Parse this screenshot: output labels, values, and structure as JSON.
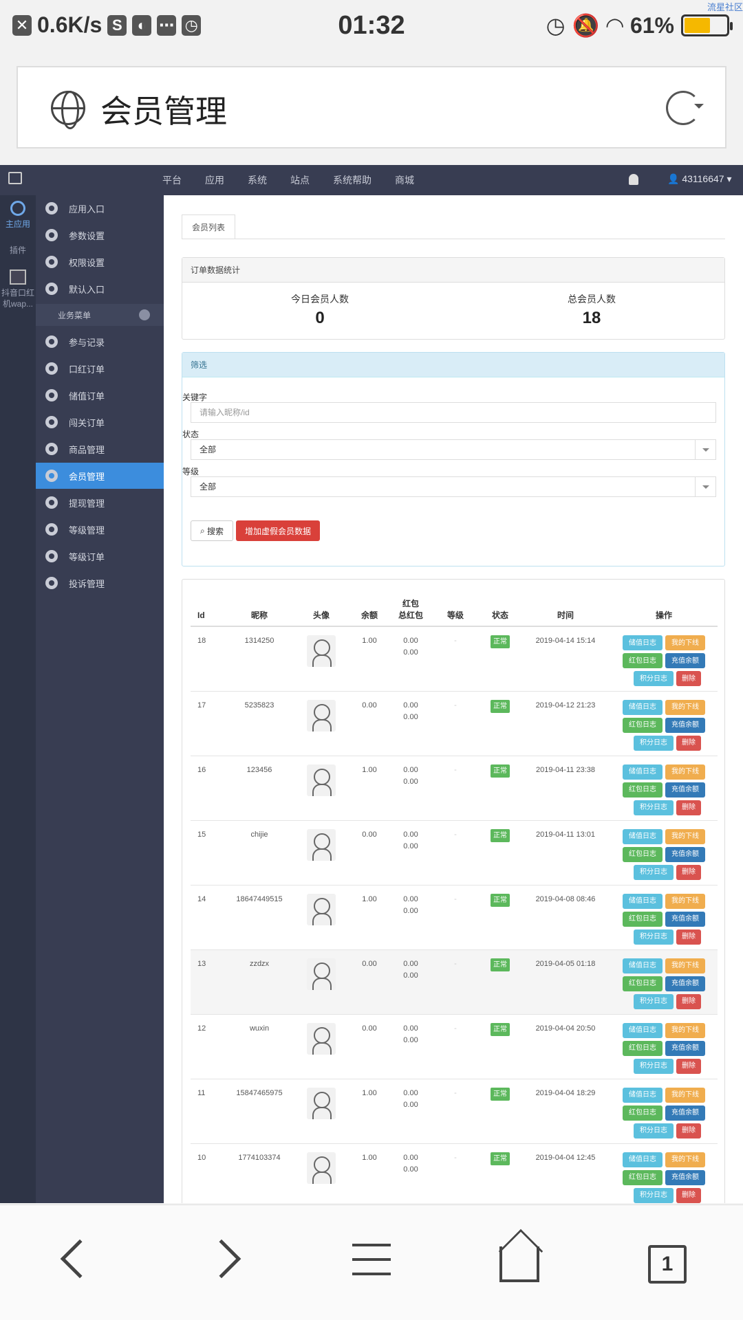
{
  "status_bar": {
    "speed": "0.6K/s",
    "time": "01:32",
    "battery": "61%",
    "battery_level": 0.61,
    "watermark": "流星社区"
  },
  "title_card": {
    "title": "会员管理"
  },
  "topnav": {
    "items": [
      "平台",
      "应用",
      "系统",
      "站点",
      "系统帮助",
      "商城"
    ],
    "user": "43116647"
  },
  "rail": {
    "main": "主应用",
    "plugin": "插件",
    "app": "抖音口红机wap..."
  },
  "sidemenu": {
    "top_items": [
      "应用入口",
      "参数设置",
      "权限设置",
      "默认入口"
    ],
    "group": "业务菜单",
    "items": [
      "参与记录",
      "口红订单",
      "储值订单",
      "闯关订单",
      "商品管理",
      "会员管理",
      "提现管理",
      "等级管理",
      "等级订单",
      "投诉管理"
    ],
    "active": "会员管理"
  },
  "content": {
    "tab": "会员列表",
    "stats": {
      "header": "订单数据统计",
      "today_label": "今日会员人数",
      "today_value": "0",
      "total_label": "总会员人数",
      "total_value": "18"
    },
    "filter": {
      "header": "筛选",
      "keyword_label": "关键字",
      "keyword_placeholder": "请输入昵称/id",
      "status_label": "状态",
      "status_value": "全部",
      "level_label": "等级",
      "level_value": "全部",
      "search_button": "搜索",
      "add_button": "增加虚假会员数据"
    },
    "table": {
      "headers": {
        "id": "Id",
        "nickname": "昵称",
        "avatar": "头像",
        "balance": "余额",
        "red_top": "红包",
        "red_bottom": "总红包",
        "level": "等级",
        "status": "状态",
        "time": "时间",
        "ops": "操作"
      },
      "ops_labels": {
        "deposit_log": "储值日志",
        "my_downline": "我的下线",
        "red_log": "红包日志",
        "recharge": "充值余额",
        "points_log": "积分日志",
        "delete": "删除"
      },
      "rows": [
        {
          "id": "18",
          "nick": "1314250",
          "balance": "1.00",
          "red": "0.00",
          "red_total": "0.00",
          "level": "-",
          "status": "正常",
          "time": "2019-04-14 15:14"
        },
        {
          "id": "17",
          "nick": "5235823",
          "balance": "0.00",
          "red": "0.00",
          "red_total": "0.00",
          "level": "-",
          "status": "正常",
          "time": "2019-04-12 21:23"
        },
        {
          "id": "16",
          "nick": "123456",
          "balance": "1.00",
          "red": "0.00",
          "red_total": "0.00",
          "level": "-",
          "status": "正常",
          "time": "2019-04-11 23:38"
        },
        {
          "id": "15",
          "nick": "chijie",
          "balance": "0.00",
          "red": "0.00",
          "red_total": "0.00",
          "level": "-",
          "status": "正常",
          "time": "2019-04-11 13:01"
        },
        {
          "id": "14",
          "nick": "18647449515",
          "balance": "1.00",
          "red": "0.00",
          "red_total": "0.00",
          "level": "-",
          "status": "正常",
          "time": "2019-04-08 08:46"
        },
        {
          "id": "13",
          "nick": "zzdzx",
          "balance": "0.00",
          "red": "0.00",
          "red_total": "0.00",
          "level": "-",
          "status": "正常",
          "time": "2019-04-05 01:18"
        },
        {
          "id": "12",
          "nick": "wuxin",
          "balance": "0.00",
          "red": "0.00",
          "red_total": "0.00",
          "level": "-",
          "status": "正常",
          "time": "2019-04-04 20:50"
        },
        {
          "id": "11",
          "nick": "15847465975",
          "balance": "1.00",
          "red": "0.00",
          "red_total": "0.00",
          "level": "-",
          "status": "正常",
          "time": "2019-04-04 18:29"
        },
        {
          "id": "10",
          "nick": "1774103374",
          "balance": "1.00",
          "red": "0.00",
          "red_total": "0.00",
          "level": "-",
          "status": "正常",
          "time": "2019-04-04 12:45"
        }
      ]
    }
  },
  "bottom_bar": {
    "tab_count": "1"
  }
}
